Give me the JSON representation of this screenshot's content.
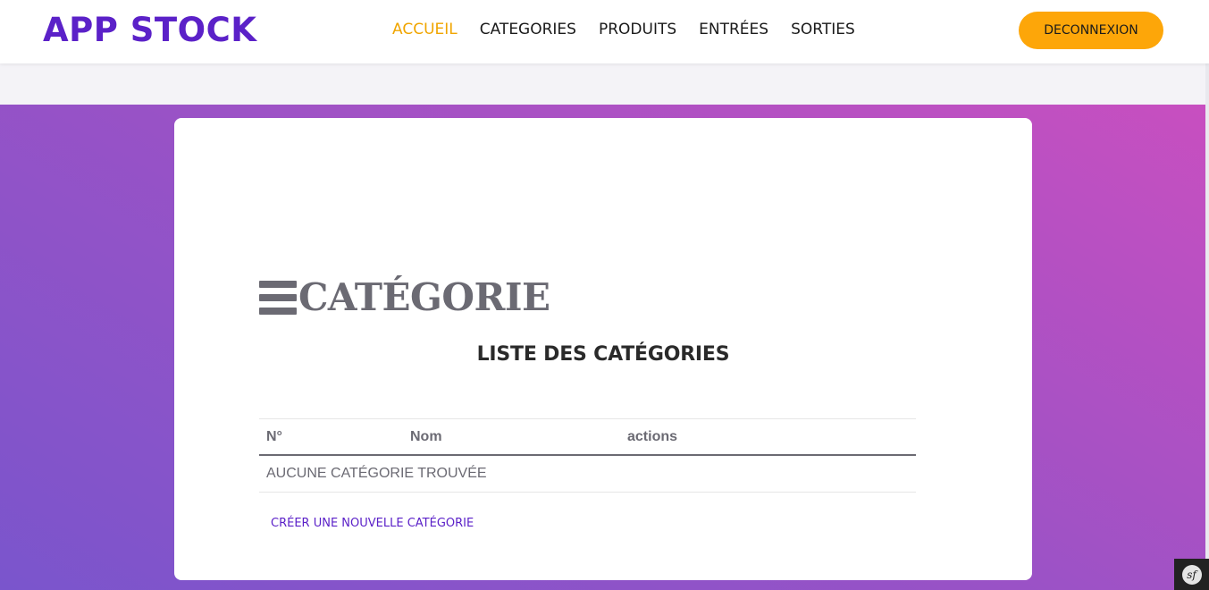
{
  "app": {
    "brand": "APP STOCK"
  },
  "nav": {
    "items": [
      {
        "label": "ACCUEIL",
        "active": true
      },
      {
        "label": "CATEGORIES",
        "active": false
      },
      {
        "label": "PRODUITS",
        "active": false
      },
      {
        "label": "ENTRÉES",
        "active": false
      },
      {
        "label": "SORTIES",
        "active": false
      }
    ],
    "logout_label": "DECONNEXION"
  },
  "page": {
    "heading": "CATÉGORIE",
    "list_title": "LISTE DES CATÉGORIES",
    "table": {
      "headers": [
        "N°",
        "Nom",
        "actions"
      ],
      "empty_message": "AUCUNE CATÉGORIE TROUVÉE"
    },
    "create_link": "CRÉER UNE NOUVELLE CATÉGORIE"
  },
  "debug_toolbar": {
    "icon": "symfony-icon",
    "glyph": "sf"
  },
  "colors": {
    "brand": "#5b21c8",
    "nav_active": "#f0a500",
    "logout_button": "#fda609",
    "gradient_start": "#7a55cc",
    "gradient_end": "#c84fc0",
    "heading_gray": "#6b6a73"
  }
}
